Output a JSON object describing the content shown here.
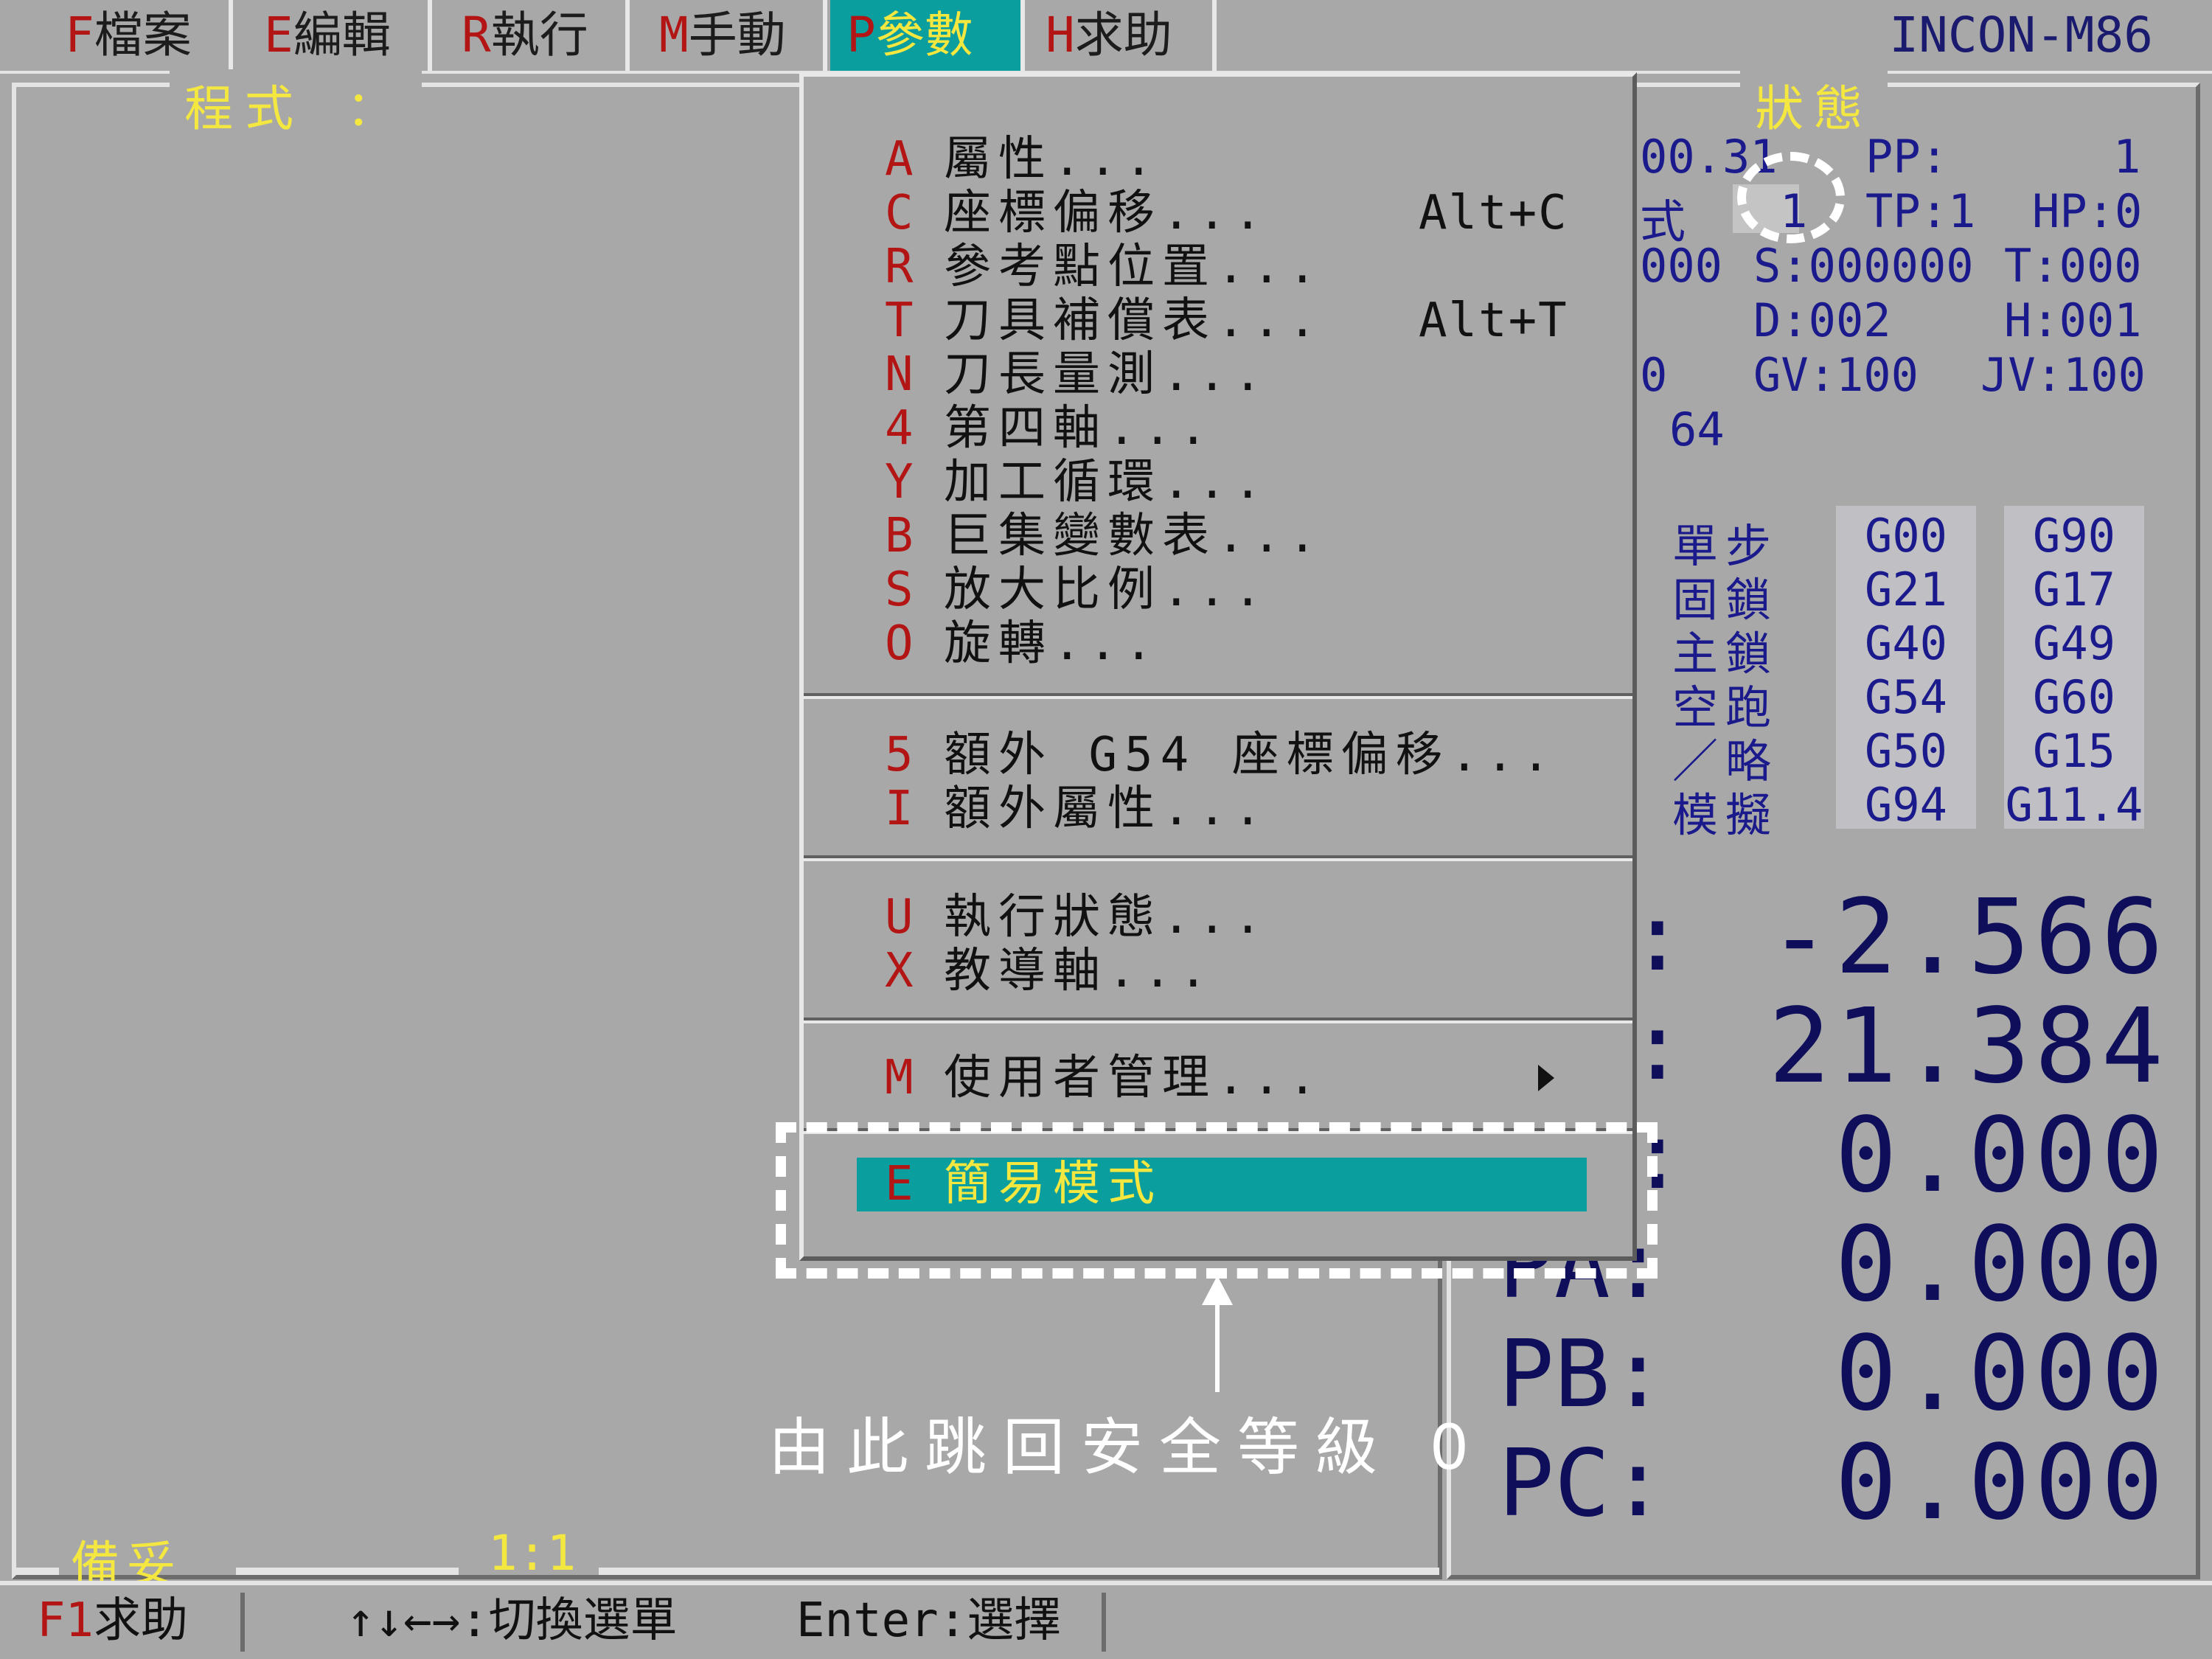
{
  "menubar": {
    "items": [
      {
        "key": "F",
        "label": "檔案"
      },
      {
        "key": "E",
        "label": "編輯"
      },
      {
        "key": "R",
        "label": "執行"
      },
      {
        "key": "M",
        "label": "手動"
      },
      {
        "key": "P",
        "label": "參數"
      },
      {
        "key": "H",
        "label": "求助"
      }
    ],
    "title": "INCON-M86"
  },
  "program_panel": {
    "label": "程式 ："
  },
  "status_panel": {
    "title": "狀態",
    "lines": {
      "l1a": "00.31",
      "l1b": "PP:",
      "l1c": "1",
      "l2a": "式",
      "l2b": "1",
      "l2c": "TP:1",
      "l2d": "HP:0",
      "l3a": "000",
      "l3b": "S:000000",
      "l3c": "T:000",
      "l4a": "D:002",
      "l4b": "H:001",
      "l5a": "0",
      "l5b": "GV:100",
      "l5c": "JV:100",
      "l6a": "64"
    },
    "modes": [
      "單步",
      "固鎖",
      "主鎖",
      "空跑",
      "／略",
      "模擬"
    ],
    "gcodes_col1": [
      "G00",
      "G21",
      "G40",
      "G54",
      "G50",
      "G94"
    ],
    "gcodes_col2": [
      "G90",
      "G17",
      "G49",
      "G60",
      "G15",
      "G11.4"
    ],
    "axes": [
      {
        "label": ":",
        "value": "-2.566"
      },
      {
        "label": ":",
        "value": "21.384"
      },
      {
        "label": ":",
        "value": "0.000"
      },
      {
        "label": "PA:",
        "value": "0.000"
      },
      {
        "label": "PB:",
        "value": "0.000"
      },
      {
        "label": "PC:",
        "value": "0.000"
      }
    ]
  },
  "dropdown": {
    "group1": [
      {
        "key": "A",
        "label": "屬性...",
        "shortcut": ""
      },
      {
        "key": "C",
        "label": "座標偏移...",
        "shortcut": "Alt+C"
      },
      {
        "key": "R",
        "label": "參考點位置...",
        "shortcut": ""
      },
      {
        "key": "T",
        "label": "刀具補償表...",
        "shortcut": "Alt+T"
      },
      {
        "key": "N",
        "label": "刀長量測...",
        "shortcut": ""
      },
      {
        "key": "4",
        "label": "第四軸...",
        "shortcut": ""
      },
      {
        "key": "Y",
        "label": "加工循環...",
        "shortcut": ""
      },
      {
        "key": "B",
        "label": "巨集變數表...",
        "shortcut": ""
      },
      {
        "key": "S",
        "label": "放大比例...",
        "shortcut": ""
      },
      {
        "key": "O",
        "label": "旋轉...",
        "shortcut": ""
      }
    ],
    "group2": [
      {
        "key": "5",
        "label": "額外 G54 座標偏移..."
      },
      {
        "key": "I",
        "label": "額外屬性..."
      }
    ],
    "group3": [
      {
        "key": "U",
        "label": "執行狀態..."
      },
      {
        "key": "X",
        "label": "教導軸..."
      }
    ],
    "group4": [
      {
        "key": "M",
        "label": "使用者管理..."
      }
    ],
    "group5": [
      {
        "key": "E",
        "label": "簡易模式"
      }
    ]
  },
  "annotation": {
    "text": "由此跳回安全等級 0"
  },
  "program_status": {
    "ready": "備妥",
    "ratio": "1:1"
  },
  "helpbar": {
    "f1_key": "F1",
    "f1_label": "求助",
    "nav": "↑↓←→:切換選單",
    "enter": "Enter:選擇"
  },
  "colors": {
    "highlight": "#0a9e9e",
    "hotkey": "#b31414",
    "yellow_text": "#f4e840",
    "status_text": "#1a1a8c"
  }
}
